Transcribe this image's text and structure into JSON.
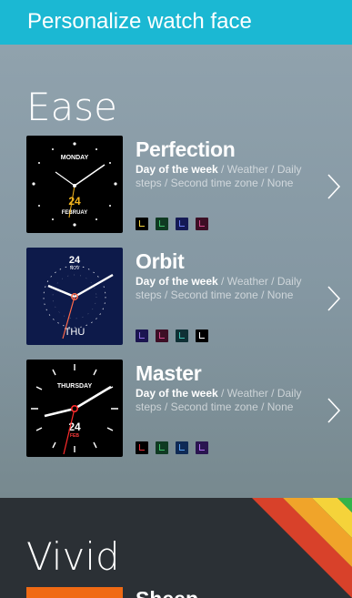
{
  "header": {
    "title": "Personalize watch face"
  },
  "sections": {
    "ease": {
      "title": "Ease",
      "items": [
        {
          "name": "Perfection",
          "desc_selected": "Day of the week",
          "desc_rest": " / Weather / Daily steps / Second time zone / None",
          "thumb": {
            "day": "MONDAY",
            "date": "24",
            "month": "FEBRUAY"
          },
          "swatches": [
            "#f2d13c",
            "#3fbf6a",
            "#6b7cf0",
            "#d04a8a"
          ]
        },
        {
          "name": "Orbit",
          "desc_selected": "Day of the week",
          "desc_rest": " / Weather / Daily steps / Second time zone / None",
          "thumb": {
            "date": "24",
            "month": "NOV",
            "day": "THU"
          },
          "swatches": [
            "#8c6fe0",
            "#d04a8a",
            "#3fbfb0",
            "#ffffff"
          ]
        },
        {
          "name": "Master",
          "desc_selected": "Day of the week",
          "desc_rest": " / Weather / Daily steps / Second time zone / None",
          "thumb": {
            "day": "THURSDAY",
            "date": "24",
            "month": "FEB"
          },
          "swatches": [
            "#e8323c",
            "#3fbf6a",
            "#5aa0f0",
            "#b070f0"
          ]
        }
      ]
    },
    "vivid": {
      "title": "Vivid",
      "items": [
        {
          "name": "Sheep"
        }
      ]
    }
  },
  "colors": {
    "accent": "#1bb8d3",
    "ease_bg": "#8a9ca7",
    "vivid_bg": "#2b3035",
    "stripe_red": "#d8412a",
    "stripe_orange": "#f0a42a",
    "stripe_yellow": "#f5d33a",
    "stripe_green": "#33b34a"
  }
}
